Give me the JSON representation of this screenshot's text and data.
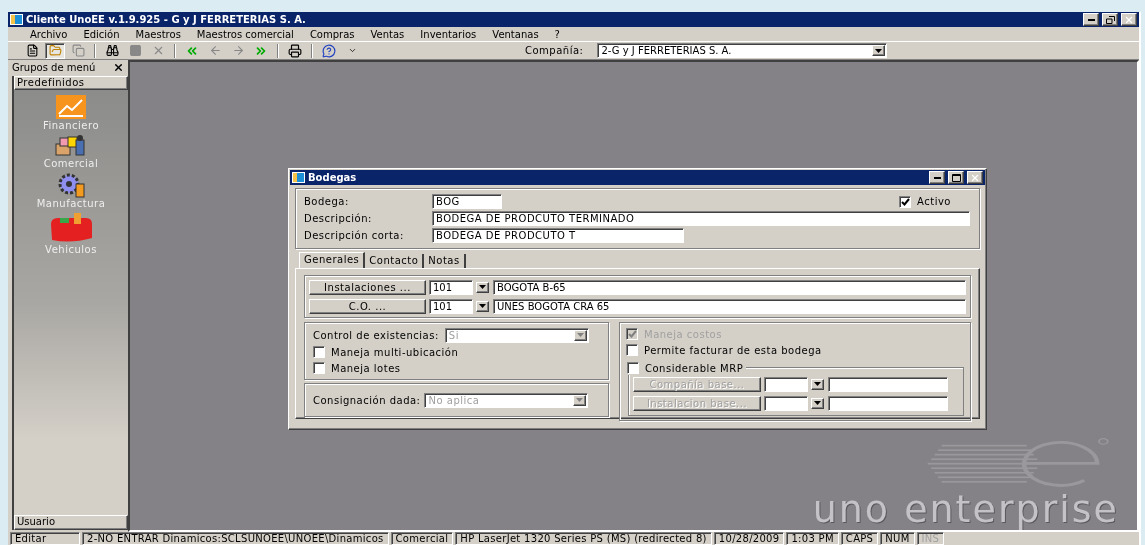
{
  "window": {
    "title": "Cliente UnoEE v.1.9.925 - G y J FERRETERIAS S. A."
  },
  "menu": [
    {
      "label": "Archivo"
    },
    {
      "label": "Edición"
    },
    {
      "label": "Maestros"
    },
    {
      "label": "Maestros comercial"
    },
    {
      "label": "Compras"
    },
    {
      "label": "Ventas"
    },
    {
      "label": "Inventarios"
    },
    {
      "label": "Ventanas"
    },
    {
      "label": "?"
    }
  ],
  "toolbar": {
    "company_label": "Compañía:",
    "company_value": "2-G y J FERRETERIAS S. A."
  },
  "sidebar": {
    "title": "Grupos de menú",
    "section": "Predefinidos",
    "items": [
      {
        "label": "Financiero"
      },
      {
        "label": "Comercial"
      },
      {
        "label": "Manufactura"
      },
      {
        "label": "Vehiculos"
      }
    ],
    "footer": "Usuario"
  },
  "dialog": {
    "title": "Bodegas",
    "fields": [
      {
        "label": "Bodega:",
        "value": "BOG"
      },
      {
        "label": "Descripción:",
        "value": "BODEGA DE PRODCUTO TERMINADO"
      },
      {
        "label": "Descripción corta:",
        "value": "BODEGA DE PRODCUTO T"
      }
    ],
    "activo": {
      "label": "Activo",
      "checked": true
    },
    "tabs": [
      {
        "label": "Generales",
        "selected": true
      },
      {
        "label": "Contacto",
        "selected": false
      },
      {
        "label": "Notas",
        "selected": false
      }
    ],
    "lookups": [
      {
        "button": "Instalaciones ...",
        "code": "101",
        "name": "BOGOTA B-65"
      },
      {
        "button": "C.O. ...",
        "code": "101",
        "name": "UNES BOGOTA CRA 65"
      }
    ],
    "control_existencias": {
      "label": "Control de existencias:",
      "value": "Si",
      "disabled": true
    },
    "left_checks": [
      {
        "label": "Maneja multi-ubicación",
        "checked": false
      },
      {
        "label": "Maneja lotes",
        "checked": false
      }
    ],
    "consignacion": {
      "label": "Consignación dada:",
      "value": "No aplica",
      "disabled": true
    },
    "right_checks": [
      {
        "label": "Maneja costos",
        "checked": true,
        "disabled": true
      },
      {
        "label": "Permite facturar de esta bodega",
        "checked": false,
        "disabled": false
      }
    ],
    "mrp": {
      "label": "Considerable MRP",
      "checked": false,
      "rows": [
        {
          "button": "Compañía base...",
          "disabled": true
        },
        {
          "button": "Instalacion base...",
          "disabled": true
        }
      ]
    }
  },
  "logo": {
    "text": "uno enterprise"
  },
  "status_bar": [
    {
      "text": "Editar",
      "disabled": false
    },
    {
      "text": "2-NO ENTRAR Dinamicos:SCLSUNOEE\\UNOEE\\Dinamicos",
      "disabled": false
    },
    {
      "text": "Comercial",
      "disabled": false
    },
    {
      "text": "HP LaserJet 1320 Series PS (MS) (redirected 8)",
      "disabled": false
    },
    {
      "text": "10/28/2009",
      "disabled": false
    },
    {
      "text": "1:03 PM",
      "disabled": false
    },
    {
      "text": "CAPS",
      "disabled": false
    },
    {
      "text": "NUM",
      "disabled": false
    },
    {
      "text": "INS",
      "disabled": true
    }
  ]
}
